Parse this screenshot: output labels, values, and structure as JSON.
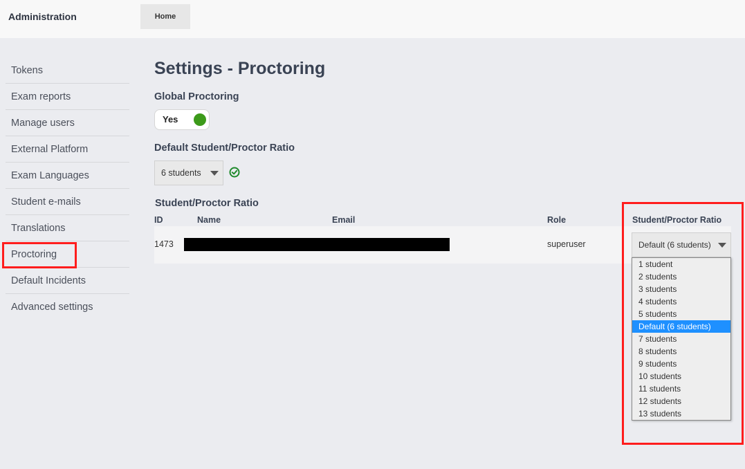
{
  "header": {
    "app_title": "Administration",
    "home_tab": "Home"
  },
  "sidebar": {
    "items": [
      {
        "label": "Tokens"
      },
      {
        "label": "Exam reports"
      },
      {
        "label": "Manage users"
      },
      {
        "label": "External Platform"
      },
      {
        "label": "Exam Languages"
      },
      {
        "label": "Student e-mails"
      },
      {
        "label": "Translations"
      },
      {
        "label": "Proctoring"
      },
      {
        "label": "Default Incidents"
      },
      {
        "label": "Advanced settings"
      }
    ],
    "active": "Proctoring"
  },
  "main": {
    "title": "Settings - Proctoring",
    "global_proctoring_label": "Global Proctoring",
    "toggle_value": "Yes",
    "toggle_on": true,
    "default_ratio_label": "Default Student/Proctor Ratio",
    "default_ratio_value": "6 students",
    "ratio_table_label": "Student/Proctor Ratio"
  },
  "table": {
    "headers": {
      "id": "ID",
      "name": "Name",
      "email": "Email",
      "role": "Role",
      "ratio": "Student/Proctor Ratio"
    },
    "rows": [
      {
        "id": "1473",
        "role": "superuser",
        "ratio": "Default (6 students)"
      }
    ]
  },
  "dropdown": {
    "options": [
      "1 student",
      "2 students",
      "3 students",
      "4 students",
      "5 students",
      "Default (6 students)",
      "7 students",
      "8 students",
      "9 students",
      "10 students",
      "11 students",
      "12 students",
      "13 students"
    ],
    "selected_index": 5
  },
  "colors": {
    "highlight": "#ff1d1d",
    "toggle_on": "#3c9a1a",
    "selected_option": "#1e90ff",
    "check": "#1f8a2c"
  }
}
